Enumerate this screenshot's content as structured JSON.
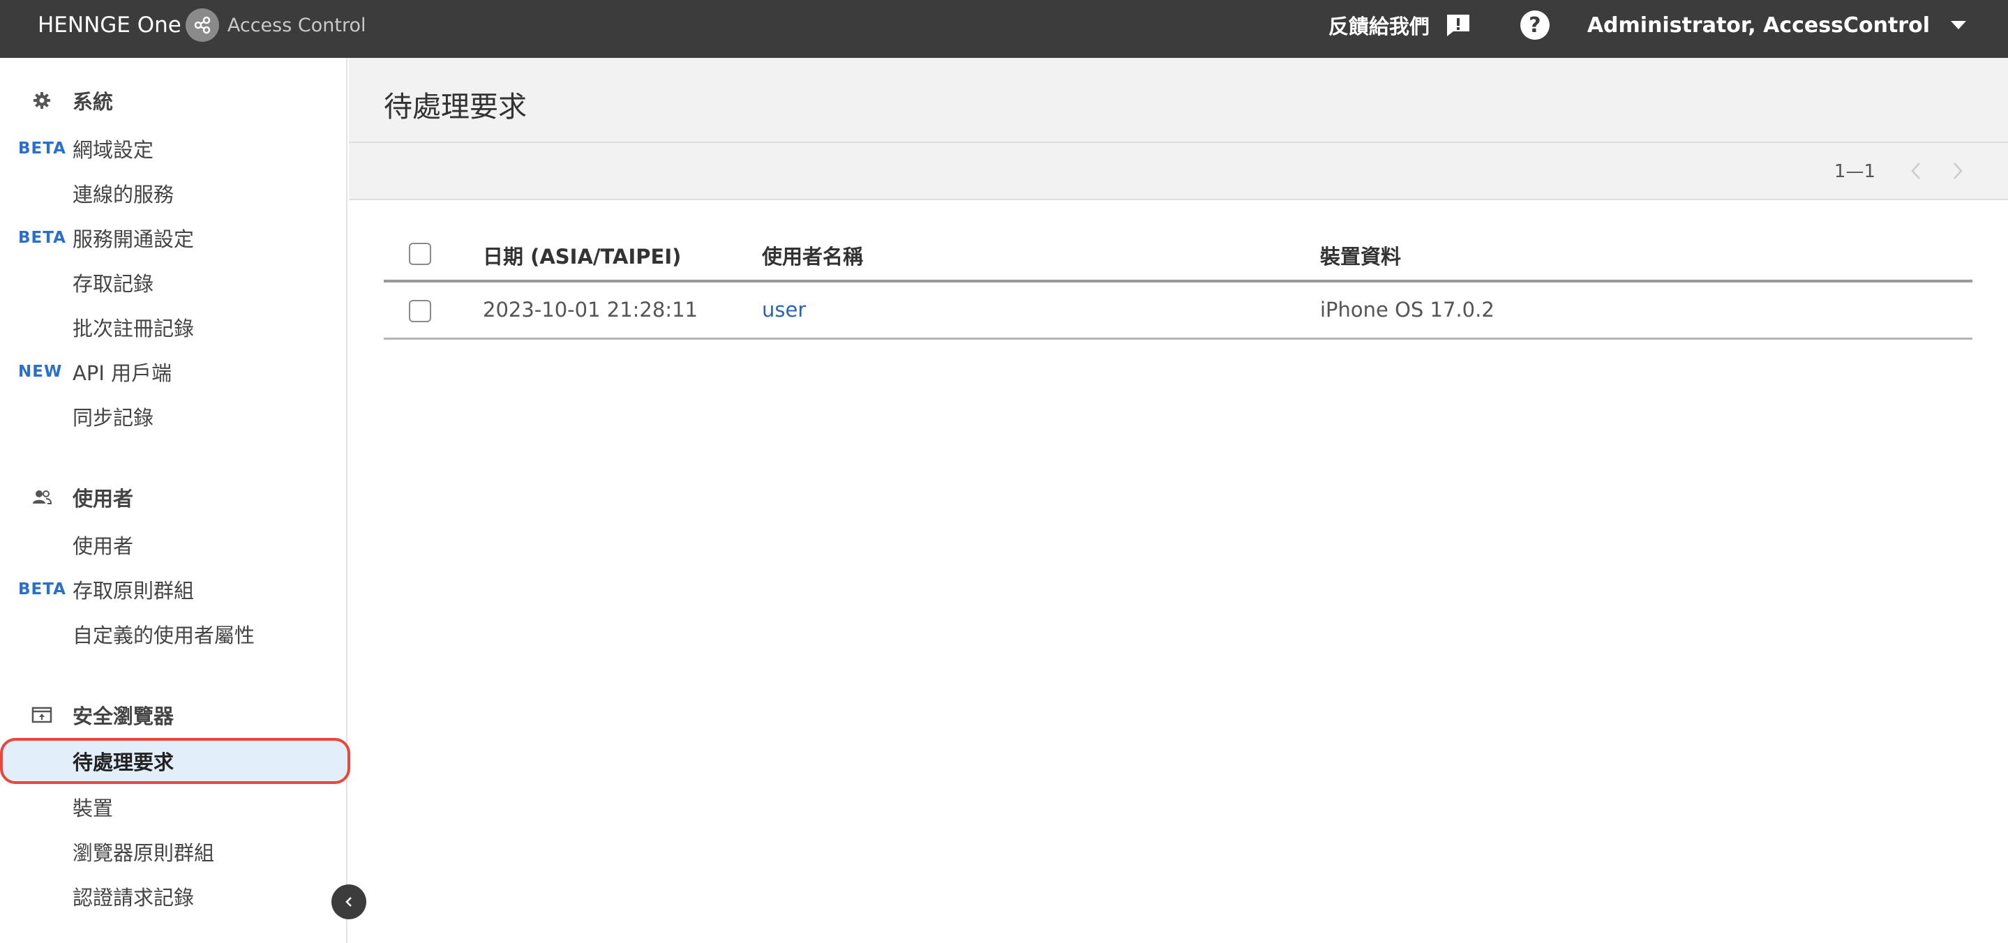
{
  "topbar": {
    "brand_name": "HENNGE One",
    "product_name": "Access Control",
    "feedback_label": "反饋給我們",
    "help_icon": "question-circle-icon",
    "user_label": "Administrator, AccessControl"
  },
  "sidebar": {
    "sections": [
      {
        "title": "系統",
        "icon": "gear-icon",
        "items": [
          {
            "badge": "BETA",
            "label": "網域設定"
          },
          {
            "badge": "",
            "label": "連線的服務"
          },
          {
            "badge": "BETA",
            "label": "服務開通設定"
          },
          {
            "badge": "",
            "label": "存取記錄"
          },
          {
            "badge": "",
            "label": "批次註冊記錄"
          },
          {
            "badge": "NEW",
            "label": "API 用戶端"
          },
          {
            "badge": "",
            "label": "同步記錄"
          }
        ]
      },
      {
        "title": "使用者",
        "icon": "users-icon",
        "items": [
          {
            "badge": "",
            "label": "使用者"
          },
          {
            "badge": "BETA",
            "label": "存取原則群組"
          },
          {
            "badge": "",
            "label": "自定義的使用者屬性"
          }
        ]
      },
      {
        "title": "安全瀏覽器",
        "icon": "secure-browser-icon",
        "items": [
          {
            "badge": "",
            "label": "待處理要求"
          },
          {
            "badge": "",
            "label": "裝置"
          },
          {
            "badge": "",
            "label": "瀏覽器原則群組"
          },
          {
            "badge": "",
            "label": "認證請求記錄"
          }
        ]
      }
    ]
  },
  "main": {
    "page_title": "待處理要求",
    "pagination": "1—1",
    "table": {
      "columns": [
        "日期 (ASIA/TAIPEI)",
        "使用者名稱",
        "裝置資料"
      ],
      "rows": [
        {
          "date": "2023-10-01 21:28:11",
          "user": "user",
          "device": "iPhone OS 17.0.2"
        }
      ]
    }
  },
  "colors": {
    "topbar_bg": "#3c3c3c",
    "badge": "#2a6fc9",
    "active_bg": "#e3eefb",
    "highlight_border": "#e8473a",
    "link": "#2a66b8"
  }
}
